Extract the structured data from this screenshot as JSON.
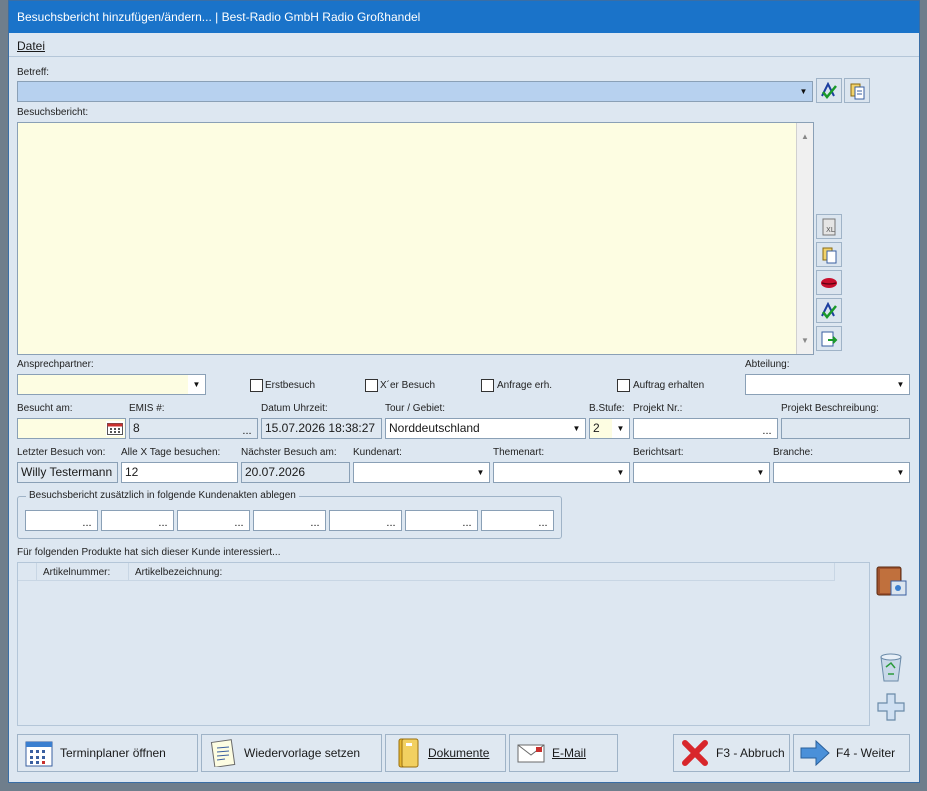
{
  "window": {
    "title": "Besuchsbericht hinzufügen/ändern... | Best-Radio GmbH Radio Großhandel"
  },
  "menu": {
    "datei": "Datei"
  },
  "betreff": {
    "label": "Betreff:",
    "value": ""
  },
  "bericht": {
    "label": "Besuchsbericht:",
    "value": ""
  },
  "row1": {
    "ansprechpartner_label": "Ansprechpartner:",
    "ansprechpartner_value": "",
    "erstbesuch": "Erstbesuch",
    "xter_besuch": "X´er Besuch",
    "anfrage": "Anfrage erh.",
    "auftrag": "Auftrag erhalten",
    "abteilung_label": "Abteilung:",
    "abteilung_value": ""
  },
  "row2": {
    "besucht_am_label": "Besucht am:",
    "besucht_am_value": "",
    "emis_label": "EMIS #:",
    "emis_value": "8",
    "datum_label": "Datum Uhrzeit:",
    "datum_value": "15.07.2026 18:38:27",
    "tour_label": "Tour / Gebiet:",
    "tour_value": "Norddeutschland",
    "bstufe_label": "B.Stufe:",
    "bstufe_value": "2",
    "projekt_nr_label": "Projekt Nr.:",
    "projekt_nr_value": "",
    "projekt_beschr_label": "Projekt Beschreibung:",
    "projekt_beschr_value": ""
  },
  "row3": {
    "letzter_label": "Letzter Besuch von:",
    "letzter_value": "Willy Testermann",
    "tage_label": "Alle X Tage besuchen:",
    "tage_value": "12",
    "naechster_label": "Nächster Besuch am:",
    "naechster_value": "20.07.2026",
    "kundenart_label": "Kundenart:",
    "themenart_label": "Themenart:",
    "berichtsart_label": "Berichtsart:",
    "branche_label": "Branche:"
  },
  "kundenakten": {
    "legend": "Besuchsbericht zusätzlich in folgende Kundenakten ablegen"
  },
  "produkte": {
    "label": "Für folgenden Produkte hat sich dieser Kunde interessiert...",
    "columns": [
      "Artikelnummer:",
      "Artikelbezeichnung:"
    ]
  },
  "buttons": {
    "terminplaner": "Terminplaner öffnen",
    "wiedervorlage": "Wiedervorlage setzen",
    "dokumente": "Dokumente",
    "email": "E-Mail",
    "abbruch": "F3 - Abbruch",
    "weiter": "F4 - Weiter"
  },
  "ellipsis": "...",
  "colors": {
    "title_bg": "#1a73c9",
    "body_bg": "#dde7f1",
    "yellow_field": "#fdfde2",
    "blue_field": "#b7d1ef"
  }
}
